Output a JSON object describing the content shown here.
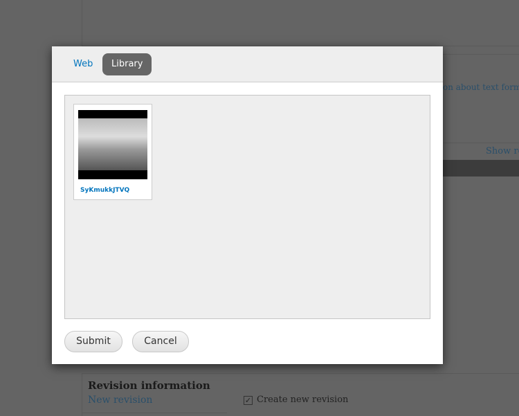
{
  "background": {
    "text_format_hint": "on about text formats",
    "show_row": "Show ro",
    "revision_title": "Revision information",
    "new_revision": "New revision",
    "create_new_revision": "Create new revision",
    "create_new_revision_checked": true
  },
  "modal": {
    "tabs": [
      {
        "label": "Web",
        "active": false
      },
      {
        "label": "Library",
        "active": true
      }
    ],
    "library": {
      "items": [
        {
          "title": "SyKmukkJTVQ"
        }
      ]
    },
    "submit_label": "Submit",
    "cancel_label": "Cancel"
  },
  "colors": {
    "link": "#0074bd",
    "active_tab": "#666666"
  }
}
